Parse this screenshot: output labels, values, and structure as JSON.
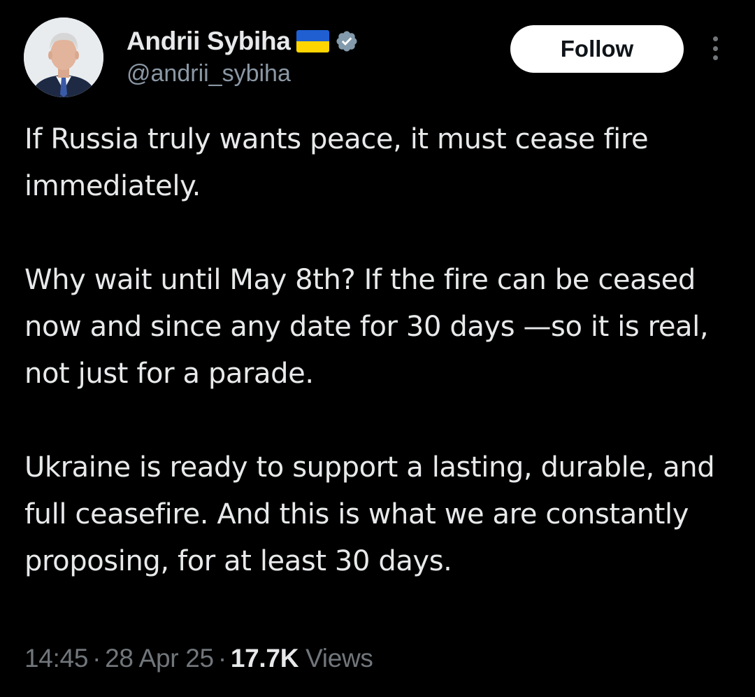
{
  "author": {
    "display_name": "Andrii Sybiha",
    "handle": "@andrii_sybiha",
    "flag_icon": "ukraine-flag-icon",
    "verified_icon": "verified-badge-icon",
    "avatar": "profile-photo"
  },
  "actions": {
    "follow_label": "Follow",
    "more_icon": "more-options-icon"
  },
  "tweet": {
    "paragraphs": [
      "If Russia truly wants peace, it must cease fire immediately.",
      "Why wait until May 8th? If the fire can be ceased now and since any date for 30 days —so it is real, not just for a parade.",
      "Ukraine is ready to support a lasting, durable, and full ceasefire. And this is what we are constantly proposing, for at least 30 days."
    ]
  },
  "meta": {
    "time": "14:45",
    "separator": "·",
    "date": "28 Apr 25",
    "views_count": "17.7K",
    "views_label": "Views"
  },
  "colors": {
    "background": "#000000",
    "text_primary": "#e7e9ea",
    "text_secondary": "#71767b",
    "verified": "#829aab",
    "flag_blue": "#1f5fd2",
    "flag_yellow": "#ffd500"
  }
}
